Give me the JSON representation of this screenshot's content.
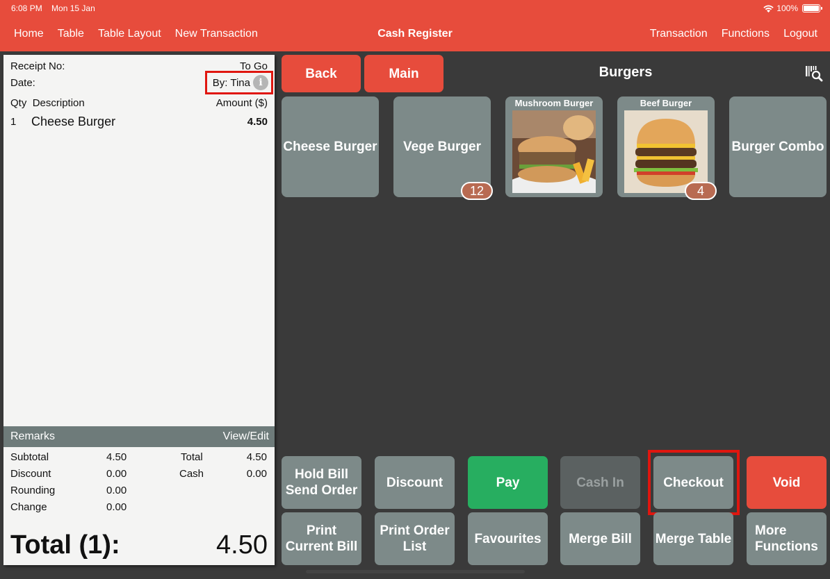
{
  "status_bar": {
    "time": "6:08 PM",
    "date": "Mon 15 Jan",
    "battery": "100%",
    "battery_level": 1.0,
    "wifi_icon": "wifi-icon"
  },
  "nav": {
    "left": [
      "Home",
      "Table",
      "Table Layout",
      "New Transaction"
    ],
    "title": "Cash Register",
    "right": [
      "Transaction",
      "Functions",
      "Logout"
    ]
  },
  "receipt": {
    "receipt_no_label": "Receipt No:",
    "order_type": "To Go",
    "date_label": "Date:",
    "by_label": "By: Tina",
    "info_icon": "info-icon",
    "col_qty": "Qty",
    "col_desc": "Description",
    "col_amount": "Amount ($)",
    "items": [
      {
        "qty": "1",
        "description": "Cheese Burger",
        "amount": "4.50"
      }
    ],
    "remarks_label": "Remarks",
    "remarks_action": "View/Edit",
    "summary": {
      "subtotal_label": "Subtotal",
      "subtotal": "4.50",
      "discount_label": "Discount",
      "discount": "0.00",
      "rounding_label": "Rounding",
      "rounding": "0.00",
      "change_label": "Change",
      "change": "0.00",
      "total_label": "Total",
      "total": "4.50",
      "cash_label": "Cash",
      "cash": "0.00"
    },
    "grand_total_label": "Total (1):",
    "grand_total": "4.50"
  },
  "menu": {
    "back_label": "Back",
    "main_label": "Main",
    "category": "Burgers",
    "barcode_icon": "barcode-search-icon",
    "items": [
      {
        "name": "Cheese Burger",
        "badge": null,
        "image": false
      },
      {
        "name": "Vege Burger",
        "badge": "12",
        "image": false
      },
      {
        "name": "Mushroom Burger",
        "badge": null,
        "image": true
      },
      {
        "name": "Beef Burger",
        "badge": "4",
        "image": true
      },
      {
        "name": "Burger Combo",
        "badge": null,
        "image": false
      }
    ]
  },
  "actions": {
    "row1": [
      "Hold Bill\nSend Order",
      "Discount",
      "Pay",
      "Cash In",
      "Checkout",
      "Void"
    ],
    "row2": [
      "Print\nCurrent Bill",
      "Print Order\nList",
      "Favourites",
      "Merge Bill",
      "Merge Table",
      "More\nFunctions"
    ]
  },
  "colors": {
    "brand_red": "#e74c3c",
    "pay_green": "#27ae60",
    "tile_gray": "#7d8a89",
    "highlight": "#e0160f"
  }
}
